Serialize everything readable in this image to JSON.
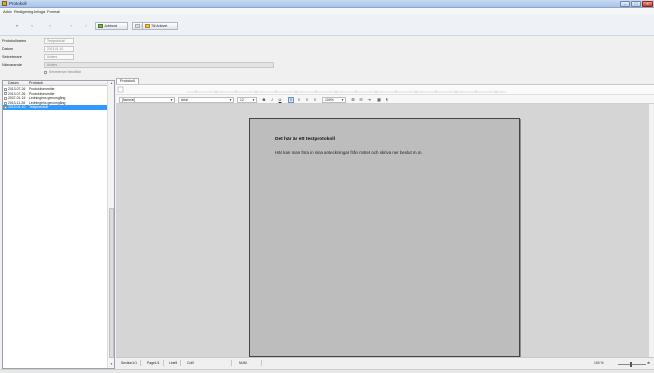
{
  "window": {
    "title": "Protokoll",
    "min": "–",
    "max": "□",
    "close": "×"
  },
  "menu": {
    "arkiv": "Arkiv",
    "redigering": "Redigering",
    "infoga": "Infoga",
    "format": "Format"
  },
  "toolbar": {
    "nav_first": "«",
    "nav_prev": "‹",
    "nav_next": "›",
    "nav_last": "»",
    "nav_save": "✓",
    "jobbord": "Jobbord",
    "forhandsgranska": "Förhandsgranska",
    "till_arkivet": "Till Arkivet"
  },
  "meta": {
    "protokollnamn_label": "Protokollnamn",
    "protokollnamn_value": "Testprotokoll",
    "datum_label": "Datum",
    "datum_value": "2013-01-10",
    "sekreterare_label": "Sekreterare",
    "sekreterare_value": "Anders",
    "narvarande_label": "Närvarande",
    "narvarande_value": "Anders",
    "checkbox_label": "Sekreterare bekräftat"
  },
  "list": {
    "col_datum": "Datum",
    "col_protokoll": "Protokoll",
    "rows": [
      {
        "date": "2013-07-26",
        "name": "Produktionsmöte"
      },
      {
        "date": "2013-07-26",
        "name": "Produktionsmöte"
      },
      {
        "date": "2007-01-15",
        "name": "Ledningens genomgång"
      },
      {
        "date": "2013-11-26",
        "name": "Ledningens genomgång"
      },
      {
        "date": "2013-01-10",
        "name": "Testprotokoll"
      }
    ]
  },
  "editor": {
    "tab": "Protokoll",
    "style": "[Normal]",
    "font": "Arial",
    "size": "12",
    "zoom_combo": "100%",
    "bold": "B",
    "italic": "I",
    "underline": "U",
    "heading": "Det här är ett testprotokoll",
    "body": "Här kan man föra in sina anteckningar från mötet och skriva ner beslut m.m."
  },
  "status": {
    "section": "Section1/1",
    "page": "Page1/1",
    "line": "Line5",
    "col": "Col0",
    "num": "NUM",
    "zoom": "100 %"
  }
}
